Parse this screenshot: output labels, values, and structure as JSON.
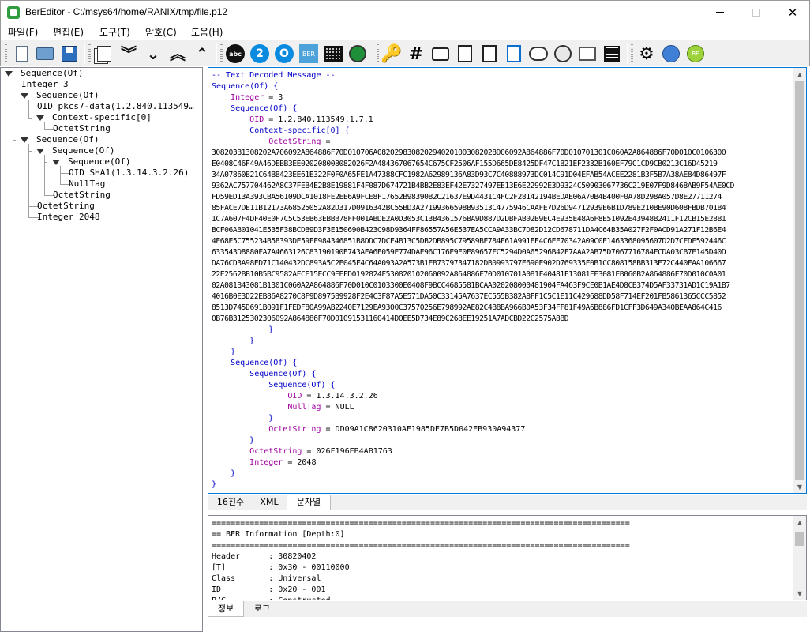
{
  "window": {
    "title": "BerEditor - C:/msys64/home/RANIX/tmp/file.p12",
    "minimize": "—",
    "close": "✕"
  },
  "menu": [
    "파일(F)",
    "편집(E)",
    "도구(T)",
    "암호(C)",
    "도움(H)"
  ],
  "toolbar": {
    "icons": [
      "new-document-icon",
      "open-folder-icon",
      "save-icon",
      "copy-icon",
      "expand-icon",
      "collapse-icon",
      "up-all-icon",
      "up-icon",
      "abc-decode-icon",
      "hex-2-icon",
      "base64-o-icon",
      "ber-icon",
      "matrix-icon",
      "globe-green-icon",
      "key-icon",
      "hash-icon",
      "message-icon",
      "page-icon",
      "sign-icon",
      "form-icon",
      "handshake-icon",
      "cms-icon",
      "book-icon",
      "list-icon",
      "gear-icon",
      "globe-blue-icon",
      "be-icon"
    ],
    "abc_label": "abc",
    "two_label": "2",
    "o_label": "O",
    "ber_label": "BER",
    "key_glyph": "🔑",
    "hash_glyph": "#",
    "gear_glyph": "⚙",
    "be_label": "BE"
  },
  "tree": [
    {
      "label": "Sequence(Of)",
      "depth": 0,
      "expanded": true
    },
    {
      "label": "Integer 3",
      "depth": 1,
      "expanded": null
    },
    {
      "label": "Sequence(Of)",
      "depth": 1,
      "expanded": true
    },
    {
      "label": "OID pkcs7-data(1.2.840.113549…",
      "depth": 2,
      "expanded": null
    },
    {
      "label": "Context-specific[0]",
      "depth": 2,
      "expanded": true
    },
    {
      "label": "OctetString",
      "depth": 3,
      "expanded": null
    },
    {
      "label": "Sequence(Of)",
      "depth": 1,
      "expanded": true
    },
    {
      "label": "Sequence(Of)",
      "depth": 2,
      "expanded": true
    },
    {
      "label": "Sequence(Of)",
      "depth": 3,
      "expanded": true
    },
    {
      "label": "OID SHA1(1.3.14.3.2.26)",
      "depth": 4,
      "expanded": null
    },
    {
      "label": "NullTag",
      "depth": 4,
      "expanded": null
    },
    {
      "label": "OctetString",
      "depth": 3,
      "expanded": null
    },
    {
      "label": "OctetString",
      "depth": 2,
      "expanded": null
    },
    {
      "label": "Integer 2048",
      "depth": 2,
      "expanded": null
    }
  ],
  "editor": {
    "header_comment": "-- Text Decoded Message --",
    "lines": [
      {
        "indent": 0,
        "type": "Sequence(Of) {"
      },
      {
        "indent": 1,
        "field": "Integer",
        "value": " = 3"
      },
      {
        "indent": 1,
        "type": "Sequence(Of) {"
      },
      {
        "indent": 2,
        "field": "OID",
        "value": " = 1.2.840.113549.1.7.1"
      },
      {
        "indent": 2,
        "type": "Context-specific[0] {"
      },
      {
        "indent": 3,
        "field": "OctetString",
        "value": " ="
      }
    ],
    "hex": [
      "308203B1308202A706092A864886F70D010706A0820298308202940201003082028D06092A864886F70D010701301C060A2A864886F70D010C0106300",
      "E0408C46F49A46DEBB3EE020208008082026F2A484367067654C675CF2506AF155D665DE8425DF47C1B21EF2332B160EF79C1CD9CB0213C16D45219",
      "34A07860B21C64BB423EE61E322F0F0A65FE1A47388CFC1982A62989136A83D93C7C40888973DC014C91D04EFAB54ACEE2281B3F5B7A38AE84D86497F",
      "9362AC757704462A8C37FEB4E2B8E19881F4F087D674721B4BB2E83EF42E7327497EE13E6E22992E3D9324C50903067736C219E07F9D8468AB9F54AE0CD",
      "FD59ED13A393CBA56109DCA1018FE2EE6A9FCE8F17652B98390B2C21637E9D4431C4FC2F28142194BEDAE06A70B4B400F0A78D298A057D8E27711274",
      "85FACE7DE11B12173A68525052A82D317D0916342BC55BD3A27199366598B93513C4775946CAAFE7D26D94712939E6B1D789E210BE90D608FBDB701B4",
      "1C7A607F4DF40E0F7C5C53EB63EBBB78FF001ABDE2A0D3053C13B4361576BA9D887D2DBFAB02B9EC4E935E48A6F8E51092E43948B2411F12CB15E28B1",
      "BCF06AB01041E535F38BCDB9D3F3E150690B423C98D9364FF86557A56E537EA5CCA9A33BC7D82D12CD678711DA4C64B35A027F2F0ACD91A271F12B6E4",
      "4E68E5C755234B5B393DE59FF984346851B8DDC7DCE4B13C5DB2DB895C79589BE784F61A991EE4C6EE70342A09C0E1463368095607D2D7CFDF592446C",
      "633543D8880FA7A4663126C83190190E743AEA6E059E774DAE96C176E9E0E89657FC5294D0A65296B42F7AAA2AB75D7067716784FCDA03CB7E145D40D",
      "DA76CD3A98ED71C140432DC893A5C2E045F4C64A093A2A573B1EB73797347182DB0993797E690E902D769335F0B1CC808158BB313E72C440EAA106667",
      "22E2562BB10B5BC9582AFCE15ECC9EEFD0192824F530820102060092A864886F70D010701A081F40481F13081EE3081EB060B2A864886F70D010C0A01",
      "02A081B43081B1301C060A2A864886F70D010C0103300E0408F9BCC4685581BCAA020208000481904FA463F9CE0B1AE4D8CB374D5AF33731AD1C19A1B7",
      "4016B0E3D22EB86A8270C8F9D8975B9928F2E4C3F87A5E571DA50C33145A7637EC555B382A8FF1C5C1E11C429688DD58F714EF201FB5861365CCC5852",
      "8513D745D691B091F1FEDF80A99AB2240E7129EA9300C37570256E798992AE82C4B8BA966B0A53F34FF81F49A6B886FD1CFF3D649A340BEAA864C416",
      "0B76B3125302306092A864886F70D01091531160414D0EE5D734E89C268EE19251A7ADCBD22C2575A8BD"
    ],
    "tail": [
      {
        "indent": 3,
        "type": "}"
      },
      {
        "indent": 2,
        "type": "}"
      },
      {
        "indent": 1,
        "type": "}"
      },
      {
        "indent": 1,
        "type": "Sequence(Of) {"
      },
      {
        "indent": 2,
        "type": "Sequence(Of) {"
      },
      {
        "indent": 3,
        "type": "Sequence(Of) {"
      },
      {
        "indent": 4,
        "field": "OID",
        "value": " = 1.3.14.3.2.26"
      },
      {
        "indent": 4,
        "field": "NullTag",
        "value": " = NULL"
      },
      {
        "indent": 3,
        "type": "}"
      },
      {
        "indent": 3,
        "field": "OctetString",
        "value": " = DD09A1C8620310AE1985DE7B5D042EB930A94377"
      },
      {
        "indent": 2,
        "type": "}"
      },
      {
        "indent": 2,
        "field": "OctetString",
        "value": " = 026F196EB4AB1763"
      },
      {
        "indent": 2,
        "field": "Integer",
        "value": " = 2048"
      },
      {
        "indent": 1,
        "type": "}"
      },
      {
        "indent": 0,
        "type": "}"
      }
    ]
  },
  "tabs_top": [
    {
      "label": "16진수",
      "active": false
    },
    {
      "label": "XML",
      "active": false
    },
    {
      "label": "문자열",
      "active": true
    }
  ],
  "info": {
    "lines": [
      "========================================================================================",
      "== BER Information [Depth:0]",
      "========================================================================================",
      "Header      : 30820402",
      "[T]         : 0x30 - 00110000",
      "Class       : Universal",
      "ID          : 0x20 - 001",
      "P/C         : Constructed"
    ]
  },
  "tabs_bottom": [
    {
      "label": "정보",
      "active": true
    },
    {
      "label": "로그",
      "active": false
    }
  ],
  "colors": {
    "type": "#0000c8",
    "field": "#a000a0",
    "accent_border": "#0078d7"
  }
}
